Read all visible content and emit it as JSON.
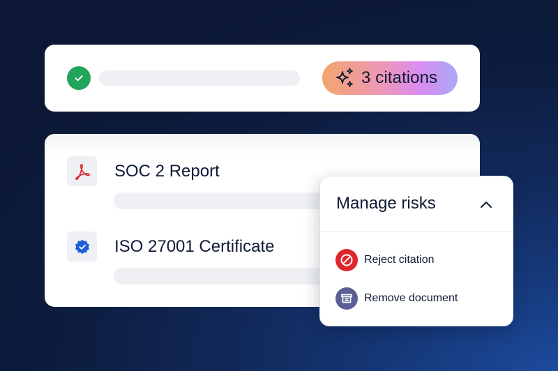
{
  "citations": {
    "label": "3 citations",
    "icon": "sparkles-icon"
  },
  "documents": [
    {
      "title": "SOC 2 Report",
      "icon": "pdf-icon",
      "icon_color": "#e0262d"
    },
    {
      "title": "ISO 27001 Certificate",
      "icon": "verified-badge-icon",
      "icon_color": "#1f5fd6"
    }
  ],
  "popover": {
    "title": "Manage risks",
    "toggle_icon": "chevron-up-icon",
    "items": [
      {
        "label": "Reject citation",
        "icon": "block-icon",
        "icon_bg": "#e0262d"
      },
      {
        "label": "Remove document",
        "icon": "archive-icon",
        "icon_bg": "#5b5f96"
      }
    ]
  },
  "colors": {
    "success": "#22a45a",
    "pill_gradient_start": "#f2a56d",
    "pill_gradient_end": "#a9a8f7",
    "text": "#0f1a36"
  }
}
